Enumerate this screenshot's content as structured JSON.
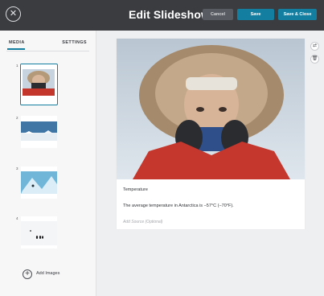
{
  "header": {
    "title": "Edit Slideshow",
    "close_icon": "close-icon",
    "close_glyph": "✕",
    "cancel_label": "Cancel",
    "save_label": "Save",
    "save_close_label": "Save & Close"
  },
  "sidebar": {
    "tabs": [
      {
        "label": "MEDIA",
        "active": true
      },
      {
        "label": "SETTINGS",
        "active": false
      }
    ],
    "items": [
      {
        "number": "1",
        "image": "explorer-portrait"
      },
      {
        "number": "2",
        "image": "icy-landscape"
      },
      {
        "number": "3",
        "image": "ice-field"
      },
      {
        "number": "4",
        "image": "penguins-on-snow"
      }
    ],
    "add_images_label": "Add Images",
    "add_icon": "plus-icon",
    "add_glyph": "+"
  },
  "slide": {
    "image": "explorer-portrait",
    "caption_title": "Temperature",
    "caption_text": "The average temperature in Antarctica is −57°C (−70°F).",
    "source_placeholder": "Add Source (Optional)",
    "swap_icon": "swap-icon",
    "swap_glyph": "⇄",
    "delete_icon": "trash-icon",
    "delete_glyph": "🗑"
  },
  "colors": {
    "topbar": "#3a3c40",
    "accent": "#137e9f",
    "cancel": "#585b61",
    "background": "#eeeff1"
  }
}
